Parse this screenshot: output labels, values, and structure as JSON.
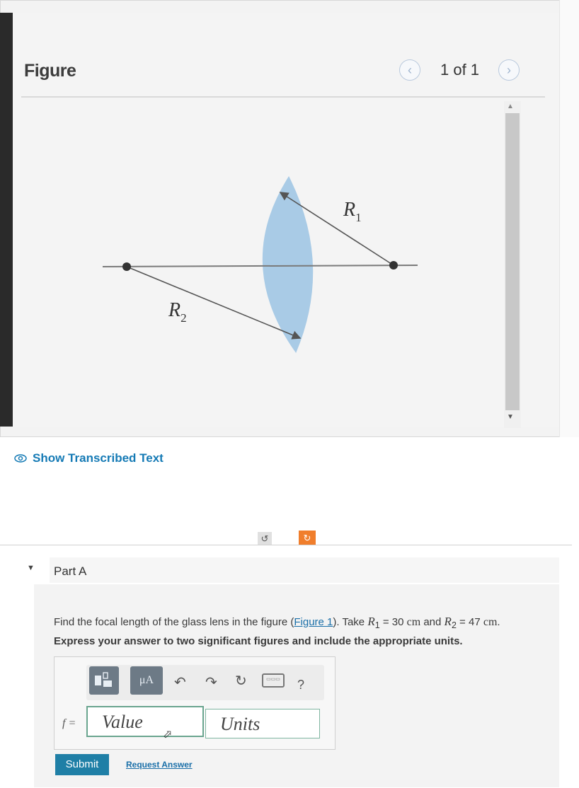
{
  "figure": {
    "title": "Figure",
    "page_indicator": "1 of 1",
    "prev_icon": "chevron-left-icon",
    "next_icon": "chevron-right-icon",
    "diagram": {
      "label_r1": "R",
      "label_r1_sub": "1",
      "label_r2": "R",
      "label_r2_sub": "2",
      "lens_color": "#a9cbe6"
    }
  },
  "transcribed": {
    "label": "Show Transcribed Text",
    "icon": "eye-icon"
  },
  "toolbar_top": {
    "undo_icon": "undo-icon",
    "reset_icon": "reset-icon"
  },
  "part": {
    "toggle_icon": "triangle-down-icon",
    "title": "Part A",
    "question_prefix": "Find the focal length of the glass lens in the figure (",
    "question_link": "Figure 1",
    "question_mid": "). Take ",
    "r1_sym": "R",
    "r1_sub": "1",
    "r1_eq": " = 30 ",
    "r1_unit": "cm",
    "and_text": " and ",
    "r2_sym": "R",
    "r2_sub": "2",
    "r2_eq": " = 47 ",
    "r2_unit": "cm",
    "question_end": ".",
    "instruction": "Express your answer to two significant figures and include the appropriate units.",
    "answer": {
      "label": "f =",
      "value_placeholder": "Value",
      "units_placeholder": "Units",
      "tools": [
        "templates-icon",
        "units-icon",
        "undo-icon",
        "redo-icon",
        "reset-icon",
        "keyboard-icon",
        "help-icon"
      ],
      "units_tool_label": "μA",
      "help_label": "?"
    },
    "submit_label": "Submit",
    "request_label": "Request Answer"
  }
}
